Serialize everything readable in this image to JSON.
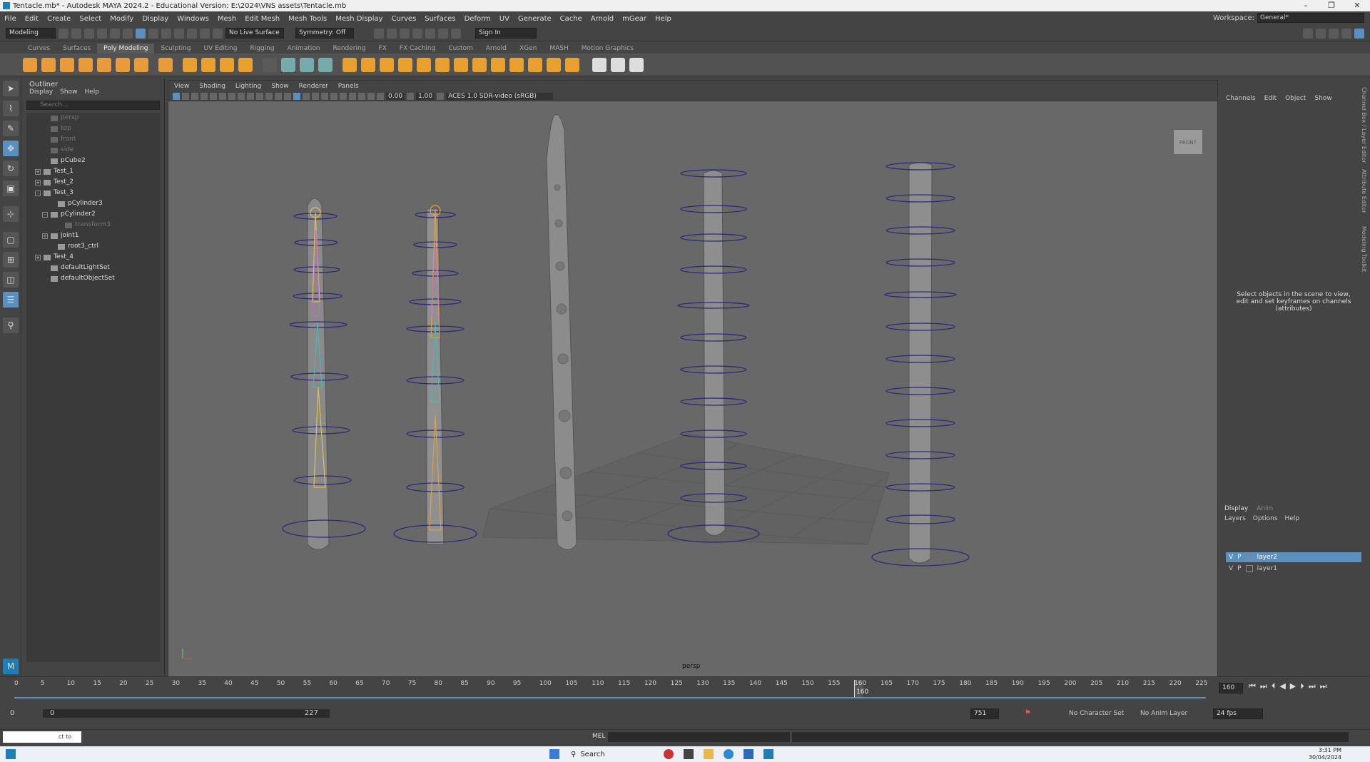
{
  "window": {
    "title": "Tentacle.mb* - Autodesk MAYA 2024.2 - Educational Version: E:\\2024\\VNS assets\\Tentacle.mb"
  },
  "menu": [
    "File",
    "Edit",
    "Create",
    "Select",
    "Modify",
    "Display",
    "Windows",
    "Mesh",
    "Edit Mesh",
    "Mesh Tools",
    "Mesh Display",
    "Curves",
    "Surfaces",
    "Deform",
    "UV",
    "Generate",
    "Cache",
    "Arnold",
    "mGear",
    "Help"
  ],
  "workspace": {
    "label": "Workspace:",
    "value": "General*"
  },
  "status": {
    "menuset": "Modeling",
    "live_surface": "No Live Surface",
    "symmetry": "Symmetry: Off",
    "sign_in": "Sign In"
  },
  "shelf_tabs": [
    "Curves",
    "Surfaces",
    "Poly Modeling",
    "Sculpting",
    "UV Editing",
    "Rigging",
    "Animation",
    "Rendering",
    "FX",
    "FX Caching",
    "Custom",
    "Arnold",
    "XGen",
    "MASH",
    "Motion Graphics"
  ],
  "shelf_active": "Poly Modeling",
  "outliner": {
    "title": "Outliner",
    "menu": [
      "Display",
      "Show",
      "Help"
    ],
    "search_placeholder": "Search...",
    "items": [
      {
        "label": "persp",
        "indent": 1,
        "dim": true,
        "exp": ""
      },
      {
        "label": "top",
        "indent": 1,
        "dim": true,
        "exp": ""
      },
      {
        "label": "front",
        "indent": 1,
        "dim": true,
        "exp": ""
      },
      {
        "label": "side",
        "indent": 1,
        "dim": true,
        "exp": ""
      },
      {
        "label": "pCube2",
        "indent": 1,
        "dim": false,
        "exp": ""
      },
      {
        "label": "Test_1",
        "indent": 0,
        "dim": false,
        "exp": "+"
      },
      {
        "label": "Test_2",
        "indent": 0,
        "dim": false,
        "exp": "+"
      },
      {
        "label": "Test_3",
        "indent": 0,
        "dim": false,
        "exp": "-"
      },
      {
        "label": "pCylinder3",
        "indent": 2,
        "dim": false,
        "exp": ""
      },
      {
        "label": "pCylinder2",
        "indent": 1,
        "dim": false,
        "exp": "-"
      },
      {
        "label": "transform3",
        "indent": 3,
        "dim": true,
        "exp": ""
      },
      {
        "label": "joint1",
        "indent": 1,
        "dim": false,
        "exp": "+"
      },
      {
        "label": "root3_ctrl",
        "indent": 2,
        "dim": false,
        "exp": ""
      },
      {
        "label": "Test_4",
        "indent": 0,
        "dim": false,
        "exp": "+"
      },
      {
        "label": "defaultLightSet",
        "indent": 1,
        "dim": false,
        "exp": ""
      },
      {
        "label": "defaultObjectSet",
        "indent": 1,
        "dim": false,
        "exp": ""
      }
    ]
  },
  "viewport": {
    "menu": [
      "View",
      "Shading",
      "Lighting",
      "Show",
      "Renderer",
      "Panels"
    ],
    "exposure": "0.00",
    "gamma": "1.00",
    "colorspace": "ACES 1.0 SDR-video (sRGB)",
    "camera_label": "persp",
    "view_cube": "FRONT"
  },
  "channelbox": {
    "menu": [
      "Channels",
      "Edit",
      "Object",
      "Show"
    ],
    "help_text": "Select objects in the scene to view, edit and set keyframes on channels (attributes)",
    "side_tabs": [
      "Channel Box / Layer Editor",
      "Attribute Editor",
      "Modeling Toolkit"
    ]
  },
  "layers": {
    "tabs": [
      "Display",
      "Anim"
    ],
    "menu": [
      "Layers",
      "Options",
      "Help"
    ],
    "rows": [
      {
        "v": "V",
        "p": "P",
        "name": "layer2",
        "selected": true
      },
      {
        "v": "V",
        "p": "P",
        "name": "layer1",
        "selected": false
      }
    ]
  },
  "timeline": {
    "ticks": [
      "0",
      "5",
      "10",
      "15",
      "20",
      "25",
      "30",
      "35",
      "40",
      "45",
      "50",
      "55",
      "60",
      "65",
      "70",
      "75",
      "80",
      "85",
      "90",
      "95",
      "100",
      "105",
      "110",
      "115",
      "120",
      "125",
      "130",
      "135",
      "140",
      "145",
      "150",
      "155",
      "160",
      "165",
      "170",
      "175",
      "180",
      "185",
      "190",
      "195",
      "200",
      "205",
      "210",
      "215",
      "220",
      "225"
    ],
    "current": "160",
    "current_frame_field": "160"
  },
  "range": {
    "start": "0",
    "inner_start": "0",
    "inner_end": "227",
    "end": "751",
    "char_set": "No Character Set",
    "anim_layer": "No Anim Layer",
    "fps": "24 fps"
  },
  "cmdline": {
    "lang": "MEL",
    "help": "ct to move."
  },
  "taskbar": {
    "search": "Search",
    "time": "3:31 PM",
    "date": "30/04/2024"
  }
}
